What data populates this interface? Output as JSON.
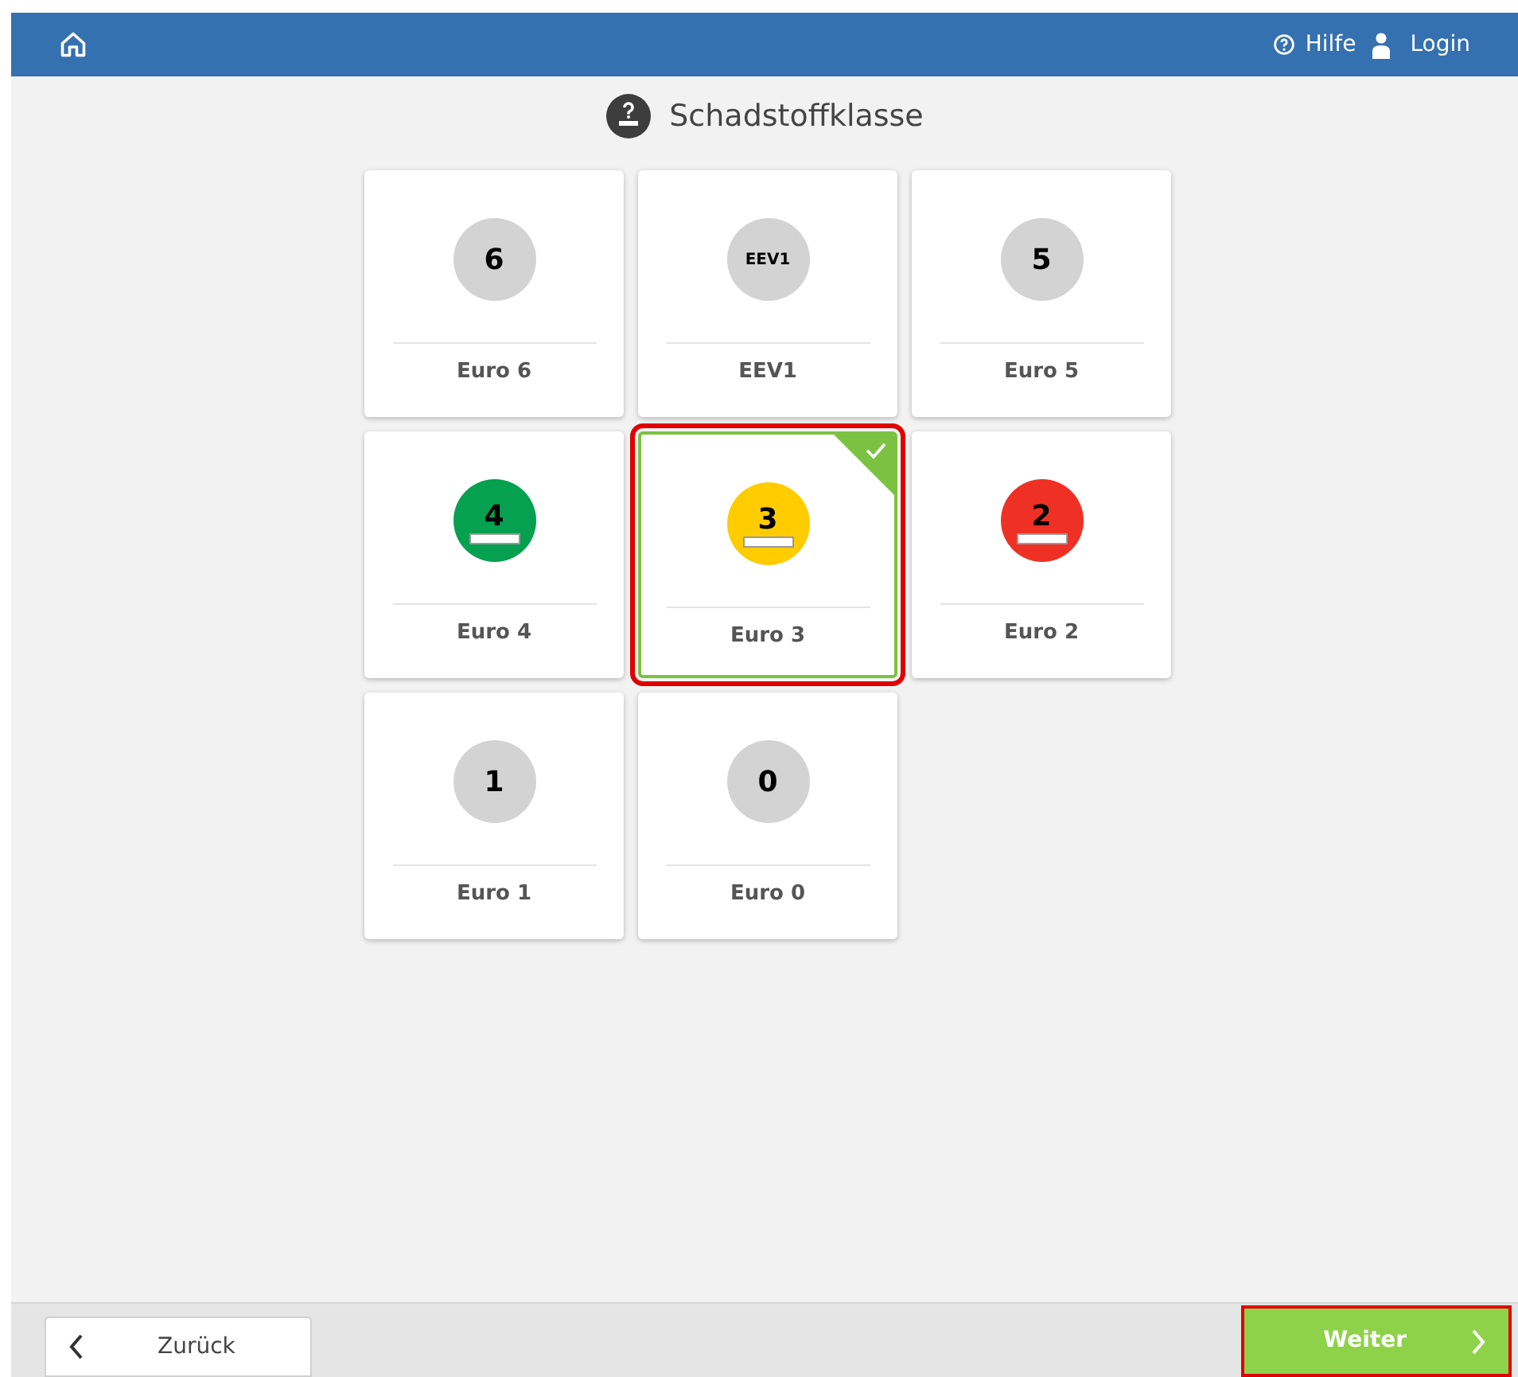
{
  "header": {
    "help": "Hilfe",
    "login": "Login"
  },
  "title": "Schadstoffklasse",
  "options": [
    {
      "badge": "6",
      "label": "Euro 6",
      "kind": "plain",
      "color": "#d3d3d3",
      "selected": false
    },
    {
      "badge": "EEV1",
      "label": "EEV1",
      "kind": "plain",
      "color": "#d3d3d3",
      "selected": false
    },
    {
      "badge": "5",
      "label": "Euro 5",
      "kind": "plain",
      "color": "#d3d3d3",
      "selected": false
    },
    {
      "badge": "4",
      "label": "Euro 4",
      "kind": "sticker",
      "color": "#05a050",
      "selected": false
    },
    {
      "badge": "3",
      "label": "Euro 3",
      "kind": "sticker",
      "color": "#ffcc00",
      "selected": true
    },
    {
      "badge": "2",
      "label": "Euro 2",
      "kind": "sticker",
      "color": "#ee3124",
      "selected": false
    },
    {
      "badge": "1",
      "label": "Euro 1",
      "kind": "plain",
      "color": "#d3d3d3",
      "selected": false
    },
    {
      "badge": "0",
      "label": "Euro 0",
      "kind": "plain",
      "color": "#d3d3d3",
      "selected": false
    }
  ],
  "footer": {
    "back": "Zurück",
    "next": "Weiter",
    "next_highlighted": true
  }
}
